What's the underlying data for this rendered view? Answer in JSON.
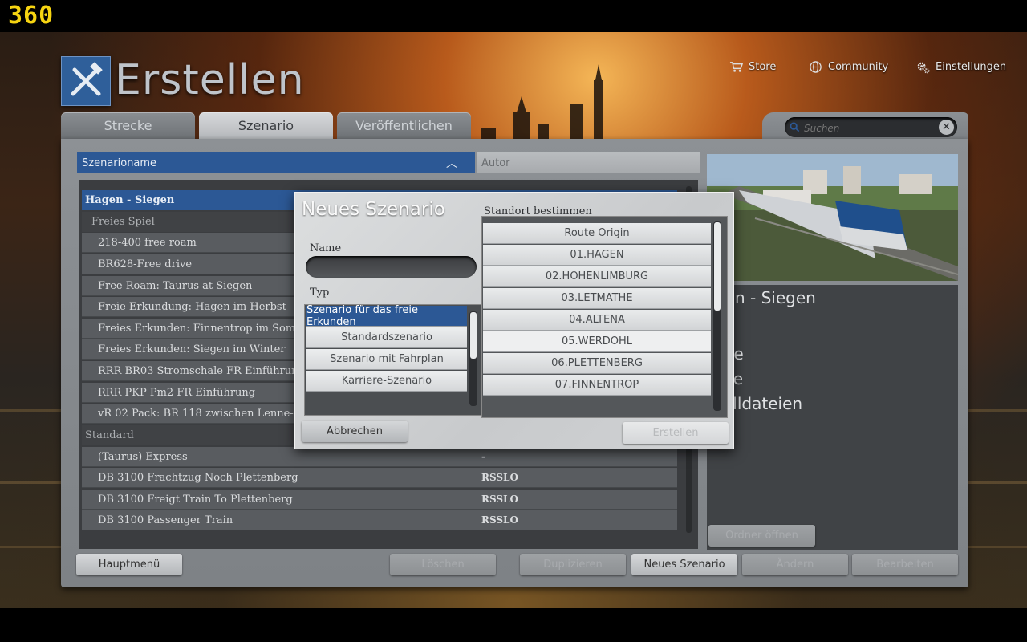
{
  "overlay": {
    "fps": "360"
  },
  "header": {
    "title": "Erstellen",
    "nav": [
      {
        "label": "Store",
        "icon": "cart-icon"
      },
      {
        "label": "Community",
        "icon": "globe-icon"
      },
      {
        "label": "Einstellungen",
        "icon": "gear-icon"
      }
    ]
  },
  "tabs": [
    {
      "label": "Strecke",
      "active": false
    },
    {
      "label": "Szenario",
      "active": true
    },
    {
      "label": "Veröffentlichen",
      "active": false
    }
  ],
  "search": {
    "placeholder": "Suchen"
  },
  "table": {
    "col_name": "Szenarioname",
    "col_author": "Autor",
    "route": "Hagen - Siegen",
    "group_free": "Freies Spiel",
    "free_items": [
      "218-400 free roam",
      "BR628-Free drive",
      "Free Roam: Taurus at Siegen",
      "Freie Erkundung: Hagen im Herbst",
      "Freies Erkunden: Finnentrop im Sommer",
      "Freies Erkunden: Siegen im Winter",
      "RRR BR03 Stromschale FR Einführung",
      "RRR PKP Pm2 FR Einführung",
      "vR 02 Pack: BR 118 zwischen Lenne- und Edertal"
    ],
    "group_standard": "Standard",
    "standard_items": [
      {
        "name": "(Taurus) Express",
        "author": "-"
      },
      {
        "name": "DB 3100 Frachtzug Noch Plettenberg",
        "author": "RSSLO"
      },
      {
        "name": "DB 3100 Freigt Train To Plettenberg",
        "author": "RSSLO"
      },
      {
        "name": "DB 3100 Passenger Train",
        "author": "RSSLO"
      }
    ]
  },
  "details": {
    "line1": "gen - Siegen",
    "line2": "ite",
    "line3": "ge",
    "line4": "elldateien",
    "open_folder": "Ordner öffnen"
  },
  "bottom": {
    "main_menu": "Hauptmenü",
    "delete": "Löschen",
    "duplicate": "Duplizieren",
    "new_scenario": "Neues Szenario",
    "edit": "Ändern",
    "edit2": "Bearbeiten"
  },
  "dialog": {
    "title": "Neues Szenario",
    "name_label": "Name",
    "name_value": "",
    "type_label": "Typ",
    "types": [
      "Szenario für das freie Erkunden",
      "Standardszenario",
      "Szenario mit Fahrplan",
      "Karriere-Szenario"
    ],
    "location_label": "Standort bestimmen",
    "locations": [
      "Route Origin",
      "01.HAGEN",
      "02.HOHENLIMBURG",
      "03.LETMATHE",
      "04.ALTENA",
      "05.WERDOHL",
      "06.PLETTENBERG",
      "07.FINNENTROP"
    ],
    "cancel": "Abbrechen",
    "create": "Erstellen"
  },
  "colors": {
    "accent_blue": "#2c5895",
    "fps_yellow": "#f6d411"
  }
}
